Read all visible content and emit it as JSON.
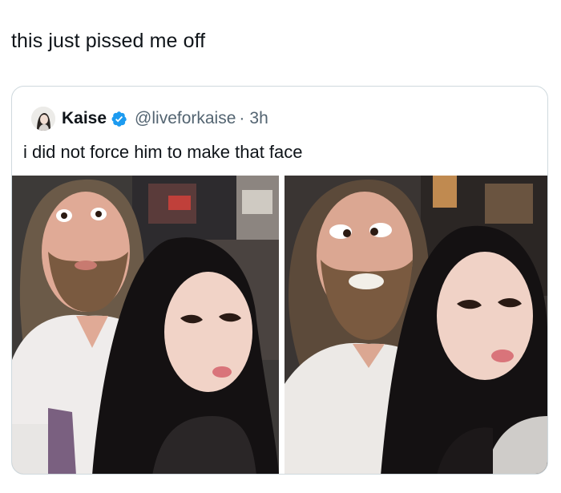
{
  "tweet": {
    "text": "this just pissed me off"
  },
  "quoted": {
    "display_name": "Kaise",
    "handle": "@liveforkaise",
    "separator": "·",
    "time": "3h",
    "text": "i did not force him to make that face",
    "verified": true,
    "verified_color": "#1d9bf0",
    "photos": [
      {
        "subject": "selfie-wide-eyes"
      },
      {
        "subject": "selfie-cross-eyed"
      }
    ]
  },
  "colors": {
    "text_primary": "#0f1419",
    "text_secondary": "#536471",
    "card_border": "#cfd9de",
    "background": "#ffffff"
  }
}
